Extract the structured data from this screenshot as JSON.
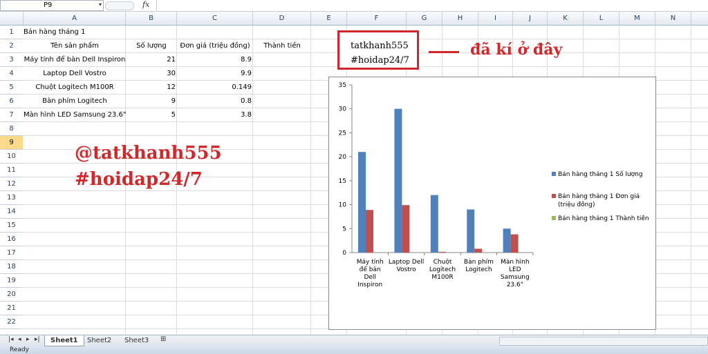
{
  "name_box": {
    "value": "P9",
    "dropdown_icon": "chevron-down-icon"
  },
  "formula_bar": {
    "fx_label": "fx",
    "value": ""
  },
  "columns": [
    "A",
    "B",
    "C",
    "D",
    "E",
    "F",
    "G",
    "H",
    "I",
    "J",
    "K",
    "L",
    "M",
    "N"
  ],
  "rows": [
    "1",
    "2",
    "3",
    "4",
    "5",
    "6",
    "7",
    "8",
    "9",
    "10",
    "11",
    "12",
    "13",
    "14",
    "15",
    "16",
    "17",
    "18",
    "19",
    "20",
    "21",
    "22"
  ],
  "selected_row": "9",
  "sheet": {
    "title": "Bán hàng tháng 1",
    "headers": {
      "product": "Tên sản phẩm",
      "qty": "Số lượng",
      "price": "Đơn giá (triệu đồng)",
      "total": "Thành tiền"
    },
    "items": [
      {
        "name": "Máy tính để bàn Dell Inspiron",
        "qty": "21",
        "price": "8.9"
      },
      {
        "name": "Laptop Dell Vostro",
        "qty": "30",
        "price": "9.9"
      },
      {
        "name": "Chuột Logitech M100R",
        "qty": "12",
        "price": "0.149"
      },
      {
        "name": "Bàn phím Logitech",
        "qty": "9",
        "price": "0.8"
      },
      {
        "name": "Màn hình LED Samsung 23.6\"",
        "qty": "5",
        "price": "3.8"
      }
    ]
  },
  "watermark": {
    "line1": "@tatkhanh555",
    "line2": "#hoidap24/7"
  },
  "signature": {
    "line1": "tatkhanh555",
    "line2": "#hoidap24/7",
    "note": "đã kí ở đây"
  },
  "chart_data": {
    "type": "bar",
    "categories": [
      [
        "Máy tính",
        "để bàn",
        "Dell",
        "Inspiron"
      ],
      [
        "Laptop Dell",
        "Vostro"
      ],
      [
        "Chuột",
        "Logitech",
        "M100R"
      ],
      [
        "Bàn phím",
        "Logitech"
      ],
      [
        "Màn hình",
        "LED",
        "Samsung",
        "23.6\""
      ]
    ],
    "series": [
      {
        "name": "Bán hàng tháng 1 Số lượng",
        "color": "#4f81bd",
        "values": [
          21,
          30,
          12,
          9,
          5
        ]
      },
      {
        "name": [
          "Bán hàng tháng 1 Đơn giá",
          "(triệu đồng)"
        ],
        "color": "#c0504d",
        "values": [
          8.9,
          9.9,
          0.149,
          0.8,
          3.8
        ]
      },
      {
        "name": "Bán hàng tháng 1 Thành tiền",
        "color": "#9bbb59",
        "values": [
          0,
          0,
          0,
          0,
          0
        ]
      }
    ],
    "yticks": [
      "0",
      "5",
      "10",
      "15",
      "20",
      "25",
      "30",
      "35"
    ],
    "ylim": [
      0,
      35
    ],
    "legend": "right"
  },
  "tabs": [
    "Sheet1",
    "Sheet2",
    "Sheet3"
  ],
  "active_tab": "Sheet1",
  "status": "Ready"
}
